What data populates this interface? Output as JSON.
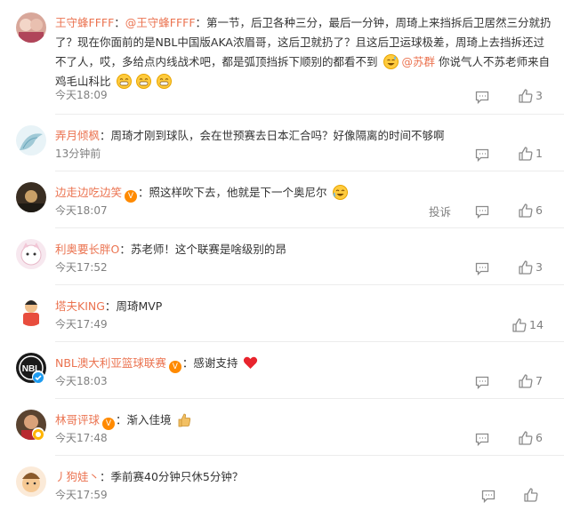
{
  "comments": [
    {
      "user": "王守蜂FFFF",
      "sep": "：",
      "mention1": "@王守蜂FFFF",
      "text1": "：第一节，后卫各种三分，最后一分钟，周琦上来挡拆后卫居然三分就扔了？现在你面前的是NBL中国版AKA浓眉哥，这后卫就扔了？且这后卫运球极差，周琦上去挡拆还过不了人，哎，多给点内线战术吧，都是弧顶挡拆下顺别的都看不到",
      "mention2": "@苏群",
      "text2": " 你说气人不苏老师来自鸡毛山科比",
      "time": "今天18:09",
      "likes": "3"
    },
    {
      "user": "弄月倾枫",
      "sep": "：",
      "text": "周琦才刚到球队，会在世预赛去日本汇合吗？好像隔离的时间不够啊",
      "time": "13分钟前",
      "likes": "1"
    },
    {
      "user": "边走边吃边笑",
      "vip": "V",
      "sep": "：",
      "text": "照这样吹下去，他就是下一个奥尼尔",
      "time": "今天18:07",
      "report": "投诉",
      "likes": "6"
    },
    {
      "user": "利奥要长胖O",
      "sep": "：",
      "text": "苏老师！这个联赛是啥级别的昂",
      "time": "今天17:52",
      "likes": "3"
    },
    {
      "user": "塔夫KING",
      "sep": "：",
      "text": "周琦MVP",
      "time": "今天17:49",
      "likes": "14"
    },
    {
      "user": "NBL澳大利亚篮球联赛",
      "vip": "V",
      "sep": "：",
      "text": "感谢支持",
      "time": "今天18:03",
      "likes": "7",
      "avatar_text": "NBL"
    },
    {
      "user": "林哥评球",
      "vip": "V",
      "sep": "：",
      "text": "渐入佳境",
      "time": "今天17:48",
      "likes": "6"
    },
    {
      "user": "丿狗娃丶",
      "sep": "：",
      "text": "季前赛40分钟只休5分钟？",
      "time": "今天17:59",
      "likes": ""
    }
  ],
  "colors": {
    "username": "#eb7350",
    "meta": "#808080",
    "text": "#333333",
    "separator": "#ececec",
    "verified": "#1d9bf0"
  },
  "icons": {
    "reply": "comment-icon",
    "like": "thumbs-up-icon",
    "emoji": "grin-emoji",
    "heart": "heart-emoji",
    "thumbs": "thumbs-up-emoji",
    "sweat": "sweat-laugh-emoji"
  }
}
